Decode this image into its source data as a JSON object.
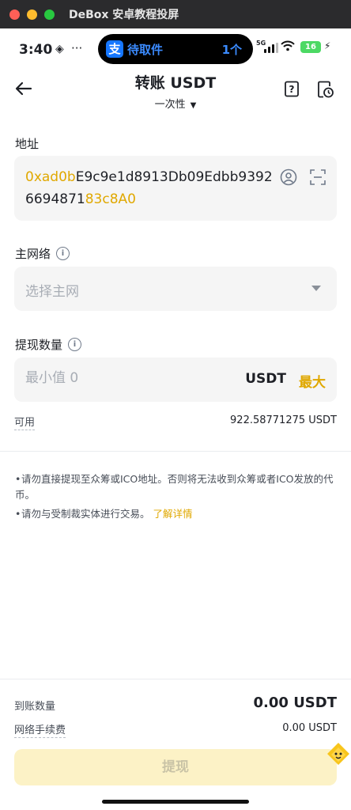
{
  "window": {
    "title": "DeBox 安卓教程投屏"
  },
  "status_bar": {
    "time": "3:40",
    "dots": "···",
    "island_app_icon": "支",
    "island_text": "待取件",
    "island_count": "1个",
    "network": "5G",
    "battery": "16"
  },
  "header": {
    "title": "转账 USDT",
    "mode": "一次性"
  },
  "address": {
    "label": "地址",
    "prefix": "0xad0b",
    "middle": "E9c9e1d8913Db09Edbb93926694871",
    "suffix": "83c8A0"
  },
  "network": {
    "label": "主网络",
    "placeholder": "选择主网"
  },
  "amount": {
    "label": "提现数量",
    "placeholder": "最小值 0",
    "unit": "USDT",
    "max_label": "最大",
    "available_label": "可用",
    "available_value": "922.58771275 USDT"
  },
  "notes": [
    "请勿直接提现至众筹或ICO地址。否则将无法收到众筹或者ICO发放的代币。",
    "请勿与受制裁实体进行交易。"
  ],
  "learn_more": "了解详情",
  "summary": {
    "receive_label": "到账数量",
    "receive_value": "0.00 USDT",
    "fee_label": "网络手续费",
    "fee_value": "0.00 USDT"
  },
  "submit_label": "提现",
  "colors": {
    "accent": "#e0a800",
    "button_disabled_bg": "#fcf2c6",
    "field_bg": "#f5f5f5"
  }
}
